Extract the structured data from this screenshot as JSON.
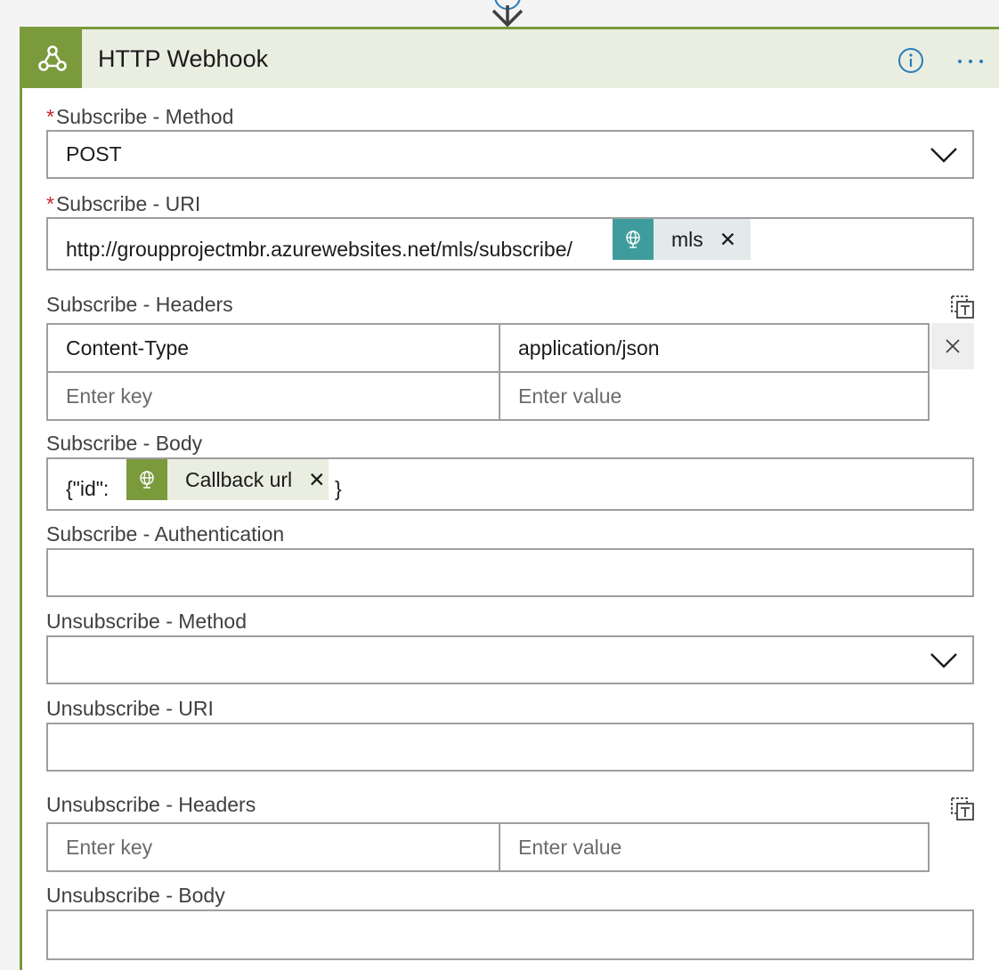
{
  "card": {
    "title": "HTTP Webhook",
    "icon": "webhook-icon",
    "info_icon": "info-icon",
    "more_icon": "ellipsis-icon",
    "accent_color": "#7a9a3c",
    "header_bg": "#e9eee0"
  },
  "fields": {
    "subscribe_method": {
      "required_mark": "*",
      "label": "Subscribe - Method",
      "value": "POST"
    },
    "subscribe_uri": {
      "required_mark": "*",
      "label": "Subscribe - URI",
      "value": "http://groupprojectmbr.azurewebsites.net/mls/subscribe/",
      "token": {
        "label": "mls",
        "remove": "✕",
        "icon": "globe-icon",
        "color": "#3f9c9c"
      }
    },
    "subscribe_headers": {
      "label": "Subscribe - Headers",
      "rows": [
        {
          "key": "Content-Type",
          "value": "application/json"
        }
      ],
      "key_placeholder": "Enter key",
      "value_placeholder": "Enter value",
      "remove_icon": "close-icon",
      "mode_icon": "text-mode-icon"
    },
    "subscribe_body": {
      "label": "Subscribe - Body",
      "prefix": "{\"id\":",
      "suffix": "}",
      "token": {
        "label": "Callback url",
        "remove": "✕",
        "icon": "globe-icon",
        "color": "#7a9a3c"
      }
    },
    "subscribe_authentication": {
      "label": "Subscribe - Authentication",
      "value": ""
    },
    "unsubscribe_method": {
      "label": "Unsubscribe - Method",
      "value": ""
    },
    "unsubscribe_uri": {
      "label": "Unsubscribe - URI",
      "value": ""
    },
    "unsubscribe_headers": {
      "label": "Unsubscribe - Headers",
      "key_placeholder": "Enter key",
      "value_placeholder": "Enter value",
      "mode_icon": "text-mode-icon"
    },
    "unsubscribe_body": {
      "label": "Unsubscribe - Body",
      "value": ""
    }
  }
}
